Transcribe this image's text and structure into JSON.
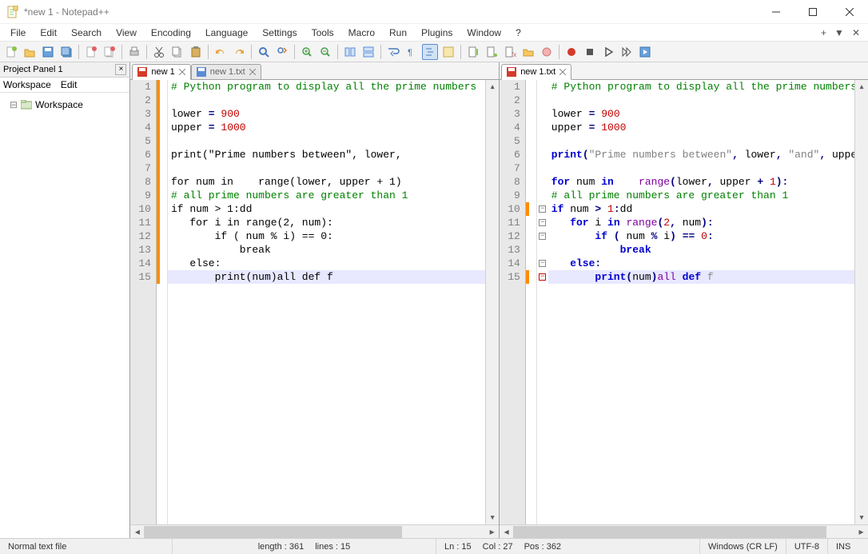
{
  "window": {
    "title": "*new 1 - Notepad++"
  },
  "menu": {
    "items": [
      "File",
      "Edit",
      "Search",
      "View",
      "Encoding",
      "Language",
      "Settings",
      "Tools",
      "Macro",
      "Run",
      "Plugins",
      "Window",
      "?"
    ]
  },
  "projectPanel": {
    "title": "Project Panel 1",
    "menu": [
      "Workspace",
      "Edit"
    ],
    "root": "Workspace"
  },
  "leftEditor": {
    "tabs": [
      {
        "label": "new 1",
        "disk_color": "#d43b2a",
        "active": true
      },
      {
        "label": "new 1.txt",
        "disk_color": "#5a8bd6",
        "active": false
      }
    ],
    "changedLines": [
      1,
      2,
      3,
      4,
      5,
      6,
      7,
      8,
      9,
      10,
      11,
      12,
      13,
      14,
      15
    ],
    "highlightLine": 15
  },
  "rightEditor": {
    "tabs": [
      {
        "label": "new 1.txt",
        "disk_color": "#d43b2a",
        "active": true
      }
    ],
    "changedLines": [
      10,
      15
    ],
    "foldLines": {
      "minus": [
        10,
        11,
        12,
        14
      ],
      "end": [
        15
      ]
    },
    "highlightLine": 15
  },
  "code": {
    "lines": [
      {
        "n": 1,
        "t": "comment",
        "text": "# Python program to display all the prime numbers"
      },
      {
        "n": 2,
        "t": "blank",
        "text": ""
      },
      {
        "n": 3,
        "t": "assign",
        "lhs": "lower",
        "rhs": "900"
      },
      {
        "n": 4,
        "t": "assign",
        "lhs": "upper",
        "rhs": "1000"
      },
      {
        "n": 5,
        "t": "blank",
        "text": ""
      },
      {
        "n": 6,
        "t": "print",
        "pre": "print",
        "str": "\"Prime numbers between\"",
        "tail": ", lower, \"and\", upper"
      },
      {
        "n": 7,
        "t": "blank",
        "text": ""
      },
      {
        "n": 8,
        "t": "for",
        "text": "for num in    range(lower, upper + 1):"
      },
      {
        "n": 9,
        "t": "comment",
        "text": "# all prime numbers are greater than 1"
      },
      {
        "n": 10,
        "t": "if1",
        "text": "if num > 1:dd"
      },
      {
        "n": 11,
        "t": "for2",
        "text": "   for i in range(2, num):"
      },
      {
        "n": 12,
        "t": "if2",
        "text": "       if ( num % i) == 0:"
      },
      {
        "n": 13,
        "t": "break",
        "text": "           break"
      },
      {
        "n": 14,
        "t": "else",
        "text": "   else:"
      },
      {
        "n": 15,
        "t": "last",
        "text": "       print(num)all def f"
      }
    ]
  },
  "statusbar": {
    "doctype": "Normal text file",
    "length": "length : 361",
    "lines": "lines : 15",
    "ln": "Ln : 15",
    "col": "Col : 27",
    "pos": "Pos : 362",
    "eol": "Windows (CR LF)",
    "encoding": "UTF-8",
    "mode": "INS"
  }
}
